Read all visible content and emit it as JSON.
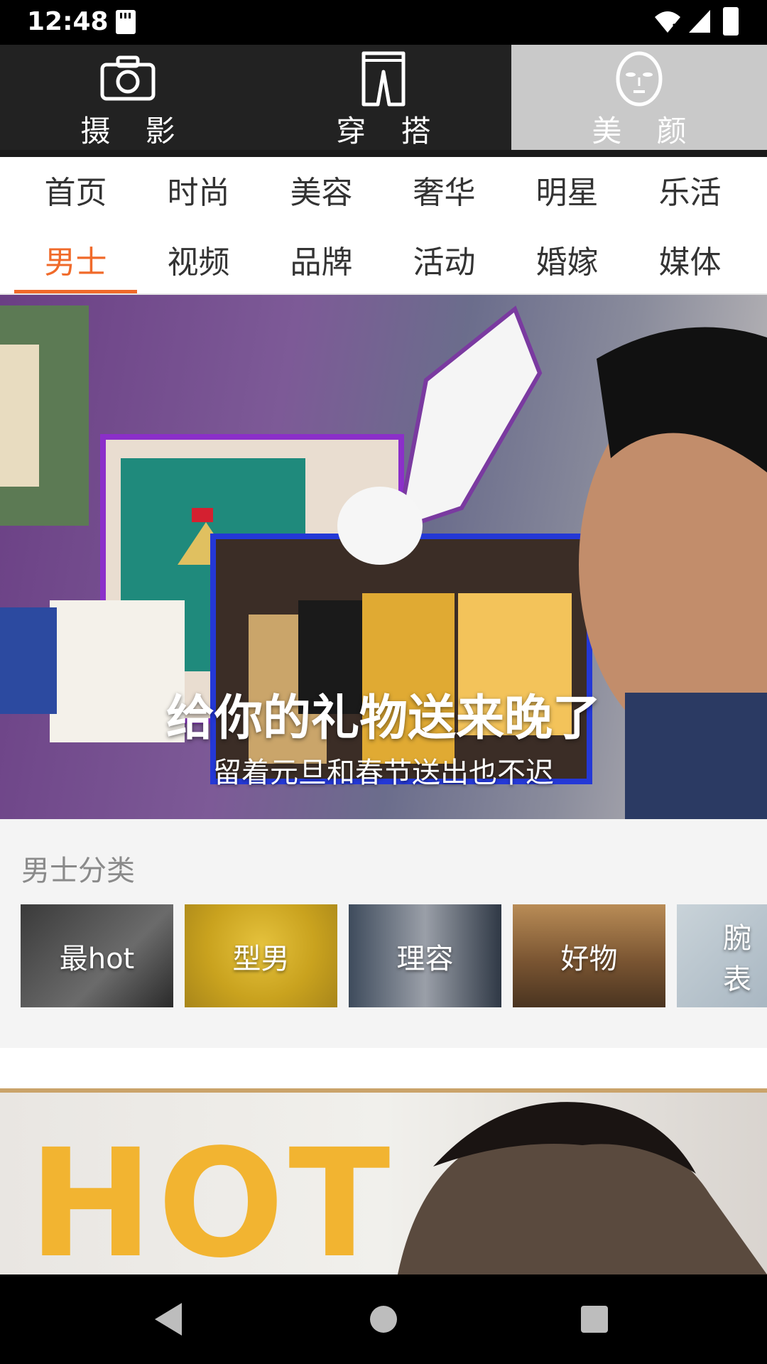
{
  "status": {
    "time": "12:48"
  },
  "mode_tabs": [
    {
      "label": "摄 影",
      "icon": "camera-icon",
      "active": false
    },
    {
      "label": "穿 搭",
      "icon": "pants-icon",
      "active": false
    },
    {
      "label": "美 颜",
      "icon": "face-mask-icon",
      "active": true
    }
  ],
  "category_tabs": {
    "row1": [
      "首页",
      "时尚",
      "美容",
      "奢华",
      "明星",
      "乐活"
    ],
    "row2": [
      "男士",
      "视频",
      "品牌",
      "活动",
      "婚嫁",
      "媒体"
    ],
    "active": "男士",
    "active_color": "#f06a2a"
  },
  "banner": {
    "title": "给你的礼物送来晚了",
    "subtitle": "留着元旦和春节送出也不迟"
  },
  "men_section": {
    "title": "男士分类",
    "cards": [
      {
        "label": "最hot"
      },
      {
        "label": "型男"
      },
      {
        "label": "理容"
      },
      {
        "label": "好物"
      },
      {
        "label": "腕表"
      }
    ]
  },
  "feature": {
    "word": "HOT"
  }
}
